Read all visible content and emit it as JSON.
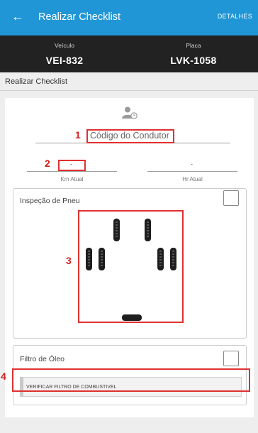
{
  "appbar": {
    "back_icon": "arrow-left-icon",
    "title": "Realizar Checklist",
    "action_label": "DETALHES",
    "color": "#2196d6"
  },
  "vehicle": {
    "vehicle_label": "Veículo",
    "vehicle_value": "VEI-832",
    "plate_label": "Placa",
    "plate_value": "LVK-1058"
  },
  "section": {
    "title": "Realizar Checklist"
  },
  "form": {
    "driver_icon": "user-clock-icon",
    "driver_placeholder": "Código do Condutor",
    "km_value": "-",
    "km_label": "Km Atual",
    "hr_value": "-",
    "hr_label": "Hr Atual"
  },
  "tire_inspection": {
    "title": "Inspeção de Pneu",
    "tire_icon": "tire-icon",
    "spare_icon": "spare-tire-icon"
  },
  "oil_filter": {
    "title": "Filtro de Óleo",
    "button_label": "VERIFICAR FILTRO DE COMBUSTIVEL"
  },
  "annotations": {
    "n1": "1",
    "n2": "2",
    "n3": "3",
    "n4": "4",
    "color": "#d41e1e"
  }
}
